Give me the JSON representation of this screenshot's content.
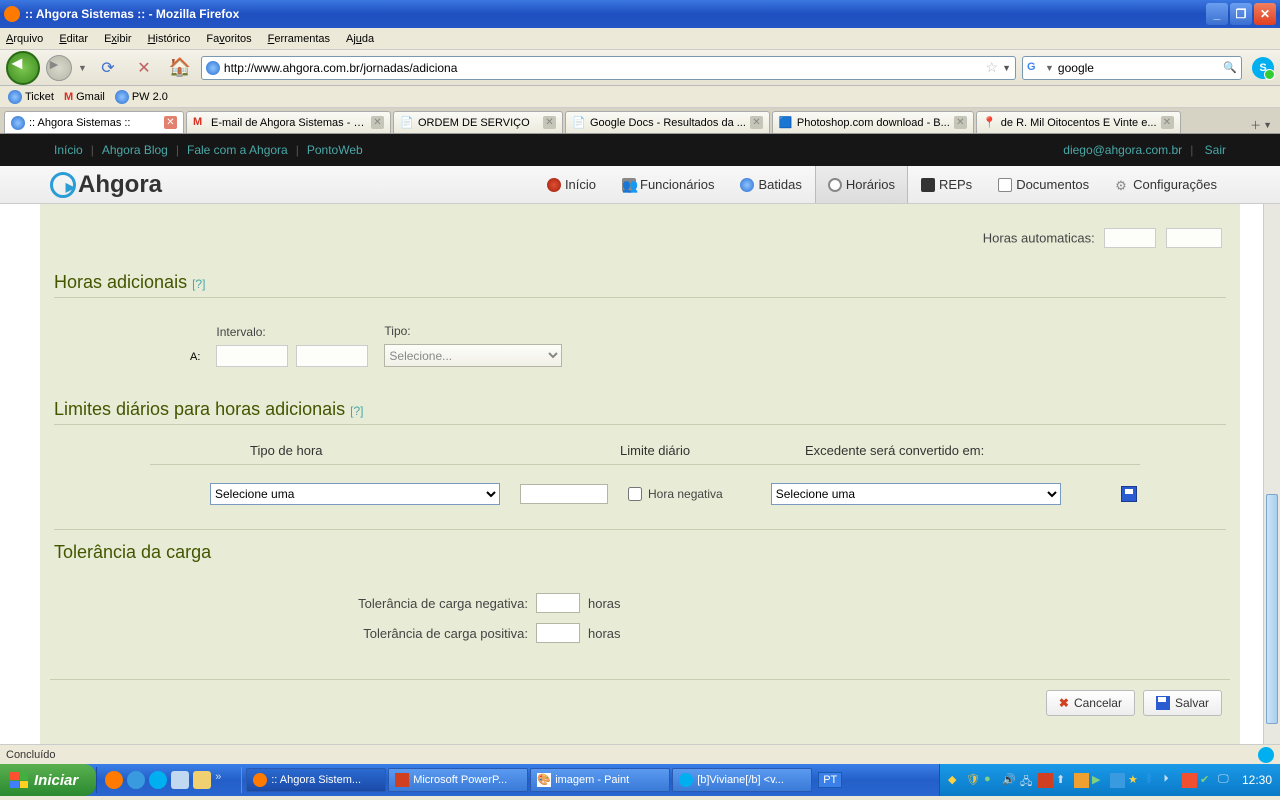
{
  "window": {
    "title": ":: Ahgora Sistemas :: - Mozilla Firefox"
  },
  "ff_menu": {
    "arquivo": "Arquivo",
    "editar": "Editar",
    "exibir": "Exibir",
    "historico": "Histórico",
    "favoritos": "Favoritos",
    "ferramentas": "Ferramentas",
    "ajuda": "Ajuda"
  },
  "url": "http://www.ahgora.com.br/jornadas/adiciona",
  "search": {
    "value": "google"
  },
  "bookmarks": {
    "ticket": "Ticket",
    "gmail": "Gmail",
    "pw": "PW 2.0"
  },
  "tabs": {
    "t1": ":: Ahgora Sistemas ::",
    "t2": "E-mail de Ahgora Sistemas - E...",
    "t3": "ORDEM DE SERVIÇO",
    "t4": "Google Docs - Resultados da ...",
    "t5": "Photoshop.com download - B...",
    "t6": "de R. Mil Oitocentos E Vinte e..."
  },
  "ah_topbar": {
    "inicio": "Início",
    "blog": "Ahgora Blog",
    "fale": "Fale com a Ahgora",
    "ponto": "PontoWeb",
    "user": "diego@ahgora.com.br",
    "sair": "Sair"
  },
  "ah_nav": {
    "inicio": "Início",
    "func": "Funcionários",
    "batidas": "Batidas",
    "horarios": "Horários",
    "reps": "REPs",
    "docs": "Documentos",
    "config": "Configurações"
  },
  "content": {
    "horas_auto_label": "Horas automaticas:",
    "sec_horas_adic": "Horas adicionais",
    "help": "[?]",
    "a_label": "A:",
    "intervalo_label": "Intervalo:",
    "tipo_label": "Tipo:",
    "tipo_placeholder": "Selecione...",
    "sec_limites": "Limites diários para horas adicionais",
    "col_tipo": "Tipo de hora",
    "col_limite": "Limite diário",
    "col_exc": "Excedente será convertido em:",
    "sel_uma": "Selecione uma",
    "hora_neg": "Hora negativa",
    "sec_tol": "Tolerância da carga",
    "tol_neg": "Tolerância de carga negativa:",
    "tol_pos": "Tolerância de carga positiva:",
    "horas": "horas",
    "cancelar": "Cancelar",
    "salvar": "Salvar"
  },
  "status": {
    "concluido": "Concluído"
  },
  "taskbar": {
    "start": "Iniciar",
    "t1": ":: Ahgora Sistem...",
    "t2": "Microsoft PowerP...",
    "t3": "imagem - Paint",
    "t4": "[b]Viviane[/b] <v...",
    "lang": "PT",
    "clock": "12:30"
  }
}
